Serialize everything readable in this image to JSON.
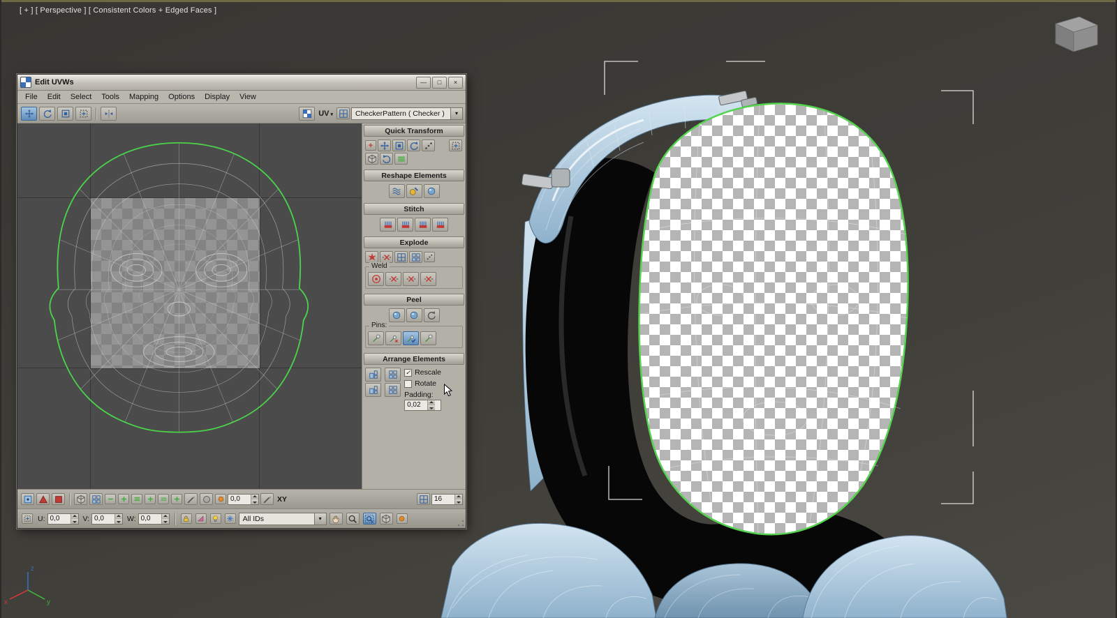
{
  "viewport": {
    "label": "[ + ] [ Perspective ] [ Consistent Colors + Edged Faces ]",
    "axis_x": "x",
    "axis_y": "y",
    "axis_z": "z"
  },
  "window": {
    "title": "Edit UVWs",
    "menus": [
      "File",
      "Edit",
      "Select",
      "Tools",
      "Mapping",
      "Options",
      "Display",
      "View"
    ],
    "toolbar": {
      "uv_label": "UV",
      "texture_dropdown": "CheckerPattern  ( Checker )"
    },
    "rollouts": {
      "quick_transform": "Quick Transform",
      "reshape_elements": "Reshape Elements",
      "stitch": "Stitch",
      "explode": "Explode",
      "weld": "Weld",
      "peel": "Peel",
      "pins": "Pins:",
      "arrange_elements": "Arrange Elements"
    },
    "arrange": {
      "rescale_label": "Rescale",
      "rescale_checked": true,
      "rotate_label": "Rotate",
      "rotate_checked": false,
      "padding_label": "Padding:",
      "padding_value": "0,02"
    },
    "bottom_toolbar": {
      "soft_value": "0,0",
      "axis_space": "XY",
      "grid_size": "16"
    },
    "status_bar": {
      "u_label": "U:",
      "u_value": "0,0",
      "v_label": "V:",
      "v_value": "0,0",
      "w_label": "W:",
      "w_value": "0,0",
      "ids_dropdown": "All IDs"
    }
  },
  "icons": {
    "minimize": "—",
    "maximize": "□",
    "close": "×",
    "dropdown_arrow": "▾",
    "check": "✓"
  },
  "colors": {
    "seam_green": "#4bd34b",
    "checker_gray": "#b5b5b5",
    "suit_blue": "#9fc0da",
    "panel_gray": "#b3b0a8"
  }
}
